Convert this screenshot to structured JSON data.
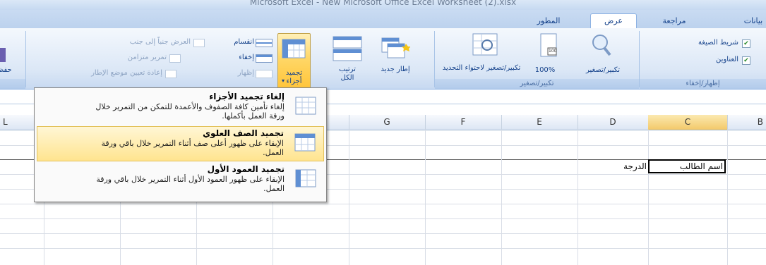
{
  "window": {
    "title": "Microsoft Excel - New Microsoft Office Excel Worksheet (2).xlsx"
  },
  "tabs": [
    {
      "label": "بيانات",
      "active": false
    },
    {
      "label": "مراجعة",
      "active": false
    },
    {
      "label": "عرض",
      "active": true
    },
    {
      "label": "المطور",
      "active": false
    }
  ],
  "ribbon": {
    "show_hide": {
      "formula_bar_label": "شريط الصيغة",
      "formula_bar_checked": true,
      "headings_label": "العناوين",
      "headings_checked": true,
      "group_label": "إظهار/إخفاء"
    },
    "zoom": {
      "zoom_label": "تكبير/تصغير",
      "hundred_label": "100%",
      "hundred_icon_text": "100",
      "fit_selection_label": "تكبير/تصغير لاحتواء التحديد",
      "group_label": "تكبير/تصغير"
    },
    "window": {
      "new_window_label": "إطار جديد",
      "arrange_all_label": "ترتيب الكل",
      "freeze_panes_label": "تجميد أجزاء",
      "split_label": "انقسام",
      "hide_label": "إخفاء",
      "unhide_label": "إظهار",
      "side_by_side_label": "العرض جنباً إلى جنب",
      "sync_scroll_label": "تمرير متزامن",
      "reset_position_label": "إعادة تعيين موضع الإطار",
      "save_workspace_label": "حفظ"
    }
  },
  "freeze_menu": {
    "items": [
      {
        "title": "إلغاء تجميد الأجزاء",
        "description": "إلغاء تأمين كافة الصفوف والأعمدة للتمكن من التمرير خلال ورقة العمل بأكملها.",
        "highlighted": false
      },
      {
        "title": "تجميد الصف العلوي",
        "description": "الإبقاء على ظهور أعلى صف أثناء التمرير خلال باقي ورقة العمل.",
        "highlighted": true
      },
      {
        "title": "تجميد العمود الأول",
        "description": "الإبقاء على ظهور العمود الأول أثناء التمرير خلال باقي ورقة العمل.",
        "highlighted": false
      }
    ]
  },
  "sheet": {
    "columns": [
      "L",
      "G",
      "F",
      "E",
      "D",
      "C",
      "B"
    ],
    "selected_column": "C",
    "cells": {
      "C1": "اسم الطالب",
      "D1": "الدرجة"
    }
  },
  "colors": {
    "ribbon_blue": "#c6d9f1",
    "highlight_gold": "#ffd767",
    "text_blue": "#15428b"
  }
}
